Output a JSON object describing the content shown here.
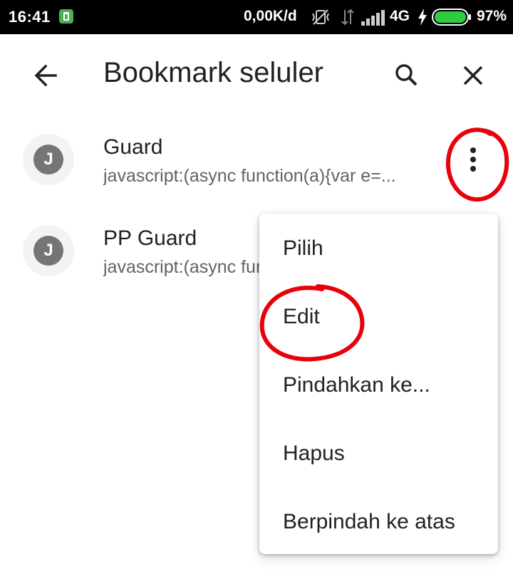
{
  "status_bar": {
    "time": "16:41",
    "network_speed": "0,00K/d",
    "network_type": "4G",
    "battery_percent": "97%",
    "battery_level": 0.97,
    "icons": [
      "app-notification-icon",
      "vibrate-off-icon",
      "data-arrows-icon",
      "signal-icon",
      "charging-bolt-icon",
      "battery-icon"
    ]
  },
  "app_bar": {
    "title": "Bookmark seluler",
    "back_icon": "arrow-back-icon",
    "search_icon": "search-icon",
    "close_icon": "close-icon"
  },
  "bookmarks": [
    {
      "initial": "J",
      "title": "Guard",
      "url": "javascript:(async function(a){var e=..."
    },
    {
      "initial": "J",
      "title": "PP Guard",
      "url": "javascript:(async function(a){var e=..."
    }
  ],
  "menu": {
    "items": [
      {
        "label": "Pilih"
      },
      {
        "label": "Edit"
      },
      {
        "label": "Pindahkan ke..."
      },
      {
        "label": "Hapus"
      },
      {
        "label": "Berpindah ke atas"
      }
    ]
  },
  "colors": {
    "status_bar_bg": "#000000",
    "avatar_bg": "#f1f3f4",
    "avatar_letter_bg": "#757575",
    "annotation_red": "#e8000b",
    "battery_green": "#2ecc40"
  }
}
